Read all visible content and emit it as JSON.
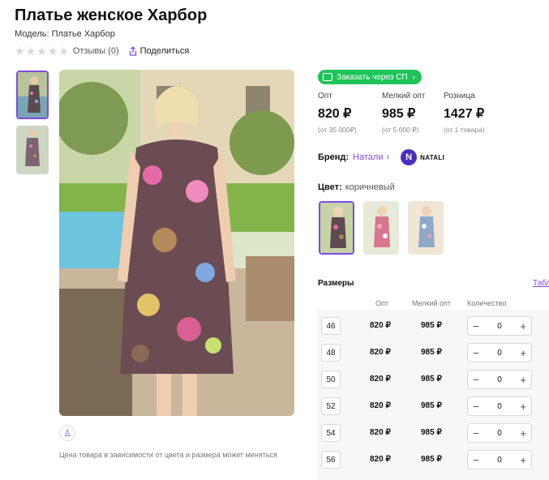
{
  "product": {
    "title": "Платье женское Харбор",
    "model": "Модель: Платье Харбор",
    "reviews": "Отзывы (0)",
    "share": "Поделиться",
    "stars": 0
  },
  "sp_button": "Заказать через СП",
  "prices": [
    {
      "label": "Опт",
      "value": "820 ₽",
      "sub": "(от 35 000₽)"
    },
    {
      "label": "Мелкий опт",
      "value": "985 ₽",
      "sub": "(от 5 000 ₽)"
    },
    {
      "label": "Розница",
      "value": "1427 ₽",
      "sub": "(от 1 товара)"
    }
  ],
  "brand": {
    "label": "Бренд:",
    "name": "Натали",
    "logo_letter": "N",
    "logo_text": "NATALI"
  },
  "color": {
    "label": "Цвет:",
    "value": "коричневый"
  },
  "sizes": {
    "heading": "Размеры",
    "table_link": "Табл",
    "headers": {
      "opt": "Опт",
      "small": "Мелкий опт",
      "qty": "Количество"
    },
    "rows": [
      {
        "size": "46",
        "opt": "820 ₽",
        "small": "985 ₽",
        "qty": "0"
      },
      {
        "size": "48",
        "opt": "820 ₽",
        "small": "985 ₽",
        "qty": "0"
      },
      {
        "size": "50",
        "opt": "820 ₽",
        "small": "985 ₽",
        "qty": "0"
      },
      {
        "size": "52",
        "opt": "820 ₽",
        "small": "985 ₽",
        "qty": "0"
      },
      {
        "size": "54",
        "opt": "820 ₽",
        "small": "985 ₽",
        "qty": "0"
      },
      {
        "size": "56",
        "opt": "820 ₽",
        "small": "985 ₽",
        "qty": "0"
      }
    ],
    "minus": "−",
    "plus": "+"
  },
  "note": "Цена товара в зависимости от цвета и размера может меняться",
  "icons": {
    "share": "share-icon",
    "cart": "cart-icon",
    "chevron": "chevron-right-icon",
    "hanger": "hanger-icon"
  },
  "accent_color": "#7b4be0",
  "sp_color": "#1fc35a"
}
